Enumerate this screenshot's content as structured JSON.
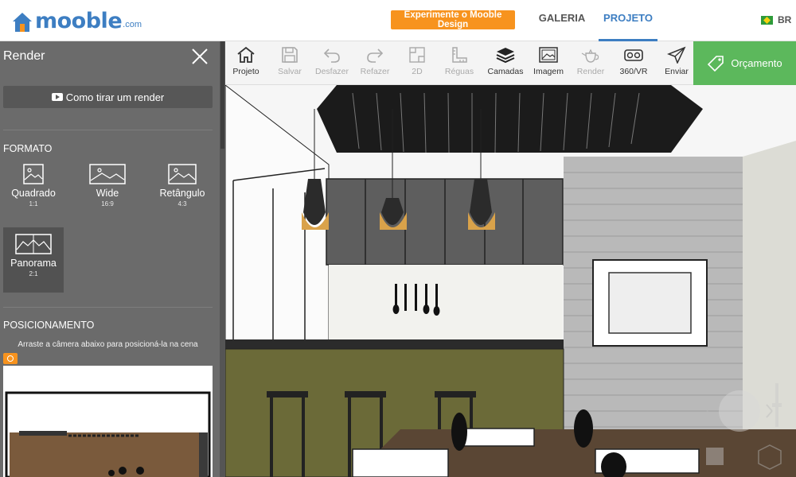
{
  "header": {
    "logo_text": "mooble",
    "logo_suffix": ".com",
    "try_button": "Experimente o Mooble Design",
    "tabs": [
      {
        "label": "GALERIA",
        "active": false
      },
      {
        "label": "PROJETO",
        "active": true
      }
    ],
    "language": "BR"
  },
  "panel": {
    "title": "Render",
    "howto_button": "Como tirar um render",
    "format_title": "FORMATO",
    "formats": [
      {
        "label": "Quadrado",
        "ratio": "1:1",
        "selected": false
      },
      {
        "label": "Wide",
        "ratio": "16:9",
        "selected": false
      },
      {
        "label": "Retângulo",
        "ratio": "4:3",
        "selected": false
      },
      {
        "label": "Panorama",
        "ratio": "2:1",
        "selected": true
      }
    ],
    "positioning_title": "POSICIONAMENTO",
    "positioning_hint": "Arraste a câmera abaixo para posicioná-la na cena"
  },
  "toolbar": {
    "items": [
      {
        "label": "Projeto",
        "icon": "home-icon",
        "enabled": true
      },
      {
        "label": "Salvar",
        "icon": "save-icon",
        "enabled": false
      },
      {
        "label": "Desfazer",
        "icon": "undo-icon",
        "enabled": false
      },
      {
        "label": "Refazer",
        "icon": "redo-icon",
        "enabled": false
      },
      {
        "label": "2D",
        "icon": "2d-icon",
        "enabled": false
      },
      {
        "label": "Réguas",
        "icon": "ruler-icon",
        "enabled": false
      },
      {
        "label": "Camadas",
        "icon": "layers-icon",
        "enabled": true
      },
      {
        "label": "Imagem",
        "icon": "image-icon",
        "enabled": true
      },
      {
        "label": "Render",
        "icon": "teapot-icon",
        "enabled": false
      },
      {
        "label": "360/VR",
        "icon": "vr-icon",
        "enabled": true
      },
      {
        "label": "Enviar",
        "icon": "send-icon",
        "enabled": true
      }
    ],
    "budget_button": "Orçamento"
  },
  "colors": {
    "accent_blue": "#3d7ec2",
    "orange": "#f7931e",
    "green": "#5cb85c",
    "panel_bg": "#6b6b6b"
  }
}
